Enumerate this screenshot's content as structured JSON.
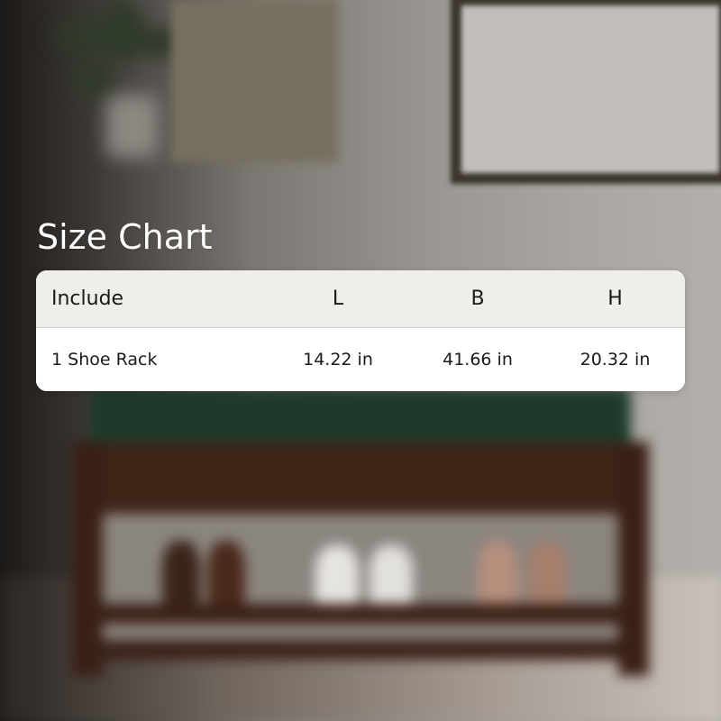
{
  "title": "Size Chart",
  "table": {
    "headers": [
      "Include",
      "L",
      "B",
      "H"
    ],
    "rows": [
      [
        "1 Shoe Rack",
        "14.22 in",
        "41.66 in",
        "20.32 in"
      ]
    ]
  },
  "colors": {
    "header_bg": "#efeeeb",
    "body_bg": "#ffffff",
    "text": "#1a1a1a",
    "title": "#ffffff"
  }
}
